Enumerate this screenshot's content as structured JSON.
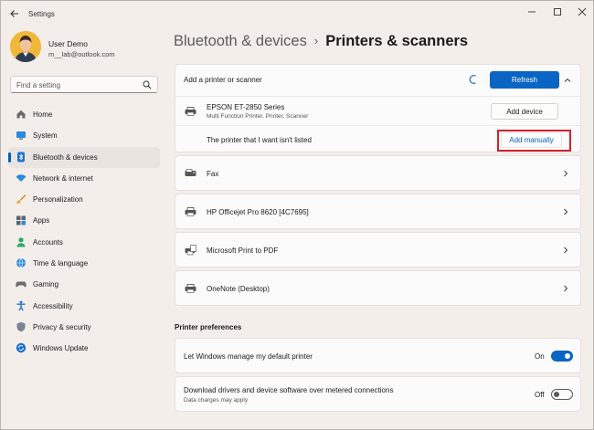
{
  "window": {
    "title": "Settings"
  },
  "profile": {
    "name": "User Demo",
    "email": "m__lab@outlook.com"
  },
  "search": {
    "placeholder": "Find a setting"
  },
  "nav": [
    {
      "label": "Home",
      "icon": "home-icon",
      "active": false
    },
    {
      "label": "System",
      "icon": "system-icon",
      "active": false
    },
    {
      "label": "Bluetooth & devices",
      "icon": "bluetooth-icon",
      "active": true
    },
    {
      "label": "Network & internet",
      "icon": "wifi-icon",
      "active": false
    },
    {
      "label": "Personalization",
      "icon": "brush-icon",
      "active": false
    },
    {
      "label": "Apps",
      "icon": "apps-icon",
      "active": false
    },
    {
      "label": "Accounts",
      "icon": "accounts-icon",
      "active": false
    },
    {
      "label": "Time & language",
      "icon": "globe-icon",
      "active": false
    },
    {
      "label": "Gaming",
      "icon": "gaming-icon",
      "active": false
    },
    {
      "label": "Accessibility",
      "icon": "accessibility-icon",
      "active": false
    },
    {
      "label": "Privacy & security",
      "icon": "shield-icon",
      "active": false
    },
    {
      "label": "Windows Update",
      "icon": "update-icon",
      "active": false
    }
  ],
  "breadcrumb": {
    "parent": "Bluetooth & devices",
    "separator": "›",
    "current": "Printers & scanners"
  },
  "add_printer": {
    "label": "Add a printer or scanner",
    "refresh_label": "Refresh",
    "found_device": {
      "name": "EPSON ET-2850 Series",
      "description": "Multi Function Printer, Printer, Scanner",
      "button": "Add device"
    },
    "not_listed": {
      "label": "The printer that I want isn't listed",
      "button": "Add manually"
    }
  },
  "printers": [
    {
      "name": "Fax",
      "icon": "fax-icon"
    },
    {
      "name": "HP Officejet Pro 8620 [4C7695]",
      "icon": "printer-icon"
    },
    {
      "name": "Microsoft Print to PDF",
      "icon": "pdf-printer-icon"
    },
    {
      "name": "OneNote (Desktop)",
      "icon": "printer-icon"
    }
  ],
  "preferences": {
    "title": "Printer preferences",
    "items": [
      {
        "label": "Let Windows manage my default printer",
        "sublabel": "",
        "state_label": "On",
        "on": true
      },
      {
        "label": "Download drivers and device software over metered connections",
        "sublabel": "Data charges may apply",
        "state_label": "Off",
        "on": false
      }
    ]
  },
  "colors": {
    "accent": "#0a64c4",
    "highlight": "#d2202f",
    "background": "#f3eeea"
  }
}
